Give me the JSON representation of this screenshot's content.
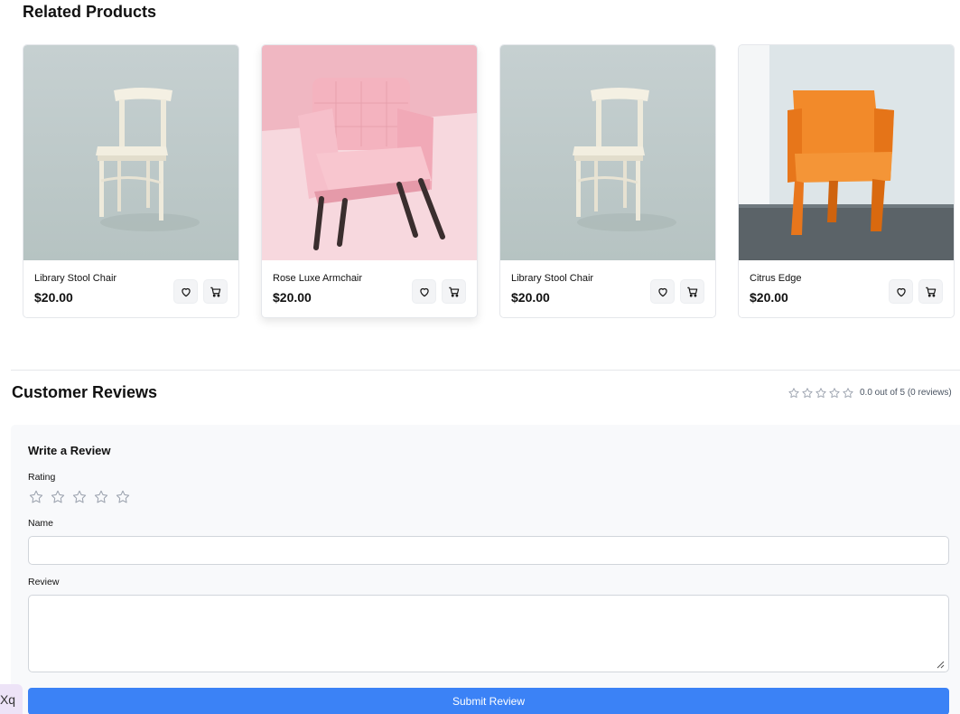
{
  "related": {
    "title": "Related Products",
    "products": [
      {
        "name": "Library Stool Chair",
        "price": "$20.00",
        "image": "white wooden chair"
      },
      {
        "name": "Rose Luxe Armchair",
        "price": "$20.00",
        "image": "pink tufted armchair"
      },
      {
        "name": "Library Stool Chair",
        "price": "$20.00",
        "image": "white wooden chair"
      },
      {
        "name": "Citrus Edge",
        "price": "$20.00",
        "image": "orange plastic chair"
      }
    ],
    "icons": {
      "favorite": "heart-icon",
      "cart": "cart-icon"
    }
  },
  "reviews": {
    "title": "Customer Reviews",
    "summary": "0.0 out of 5 (0 reviews)",
    "average_rating": 0,
    "review_count": 0,
    "form": {
      "title": "Write a Review",
      "rating_label": "Rating",
      "rating_value": 0,
      "name_label": "Name",
      "name_value": "",
      "review_label": "Review",
      "review_value": "",
      "submit_label": "Submit Review"
    }
  },
  "widget": {
    "text": "Xq"
  },
  "colors": {
    "accent": "#3b82f6",
    "star_empty": "#9ca3af",
    "panel": "#f8f9fb"
  }
}
